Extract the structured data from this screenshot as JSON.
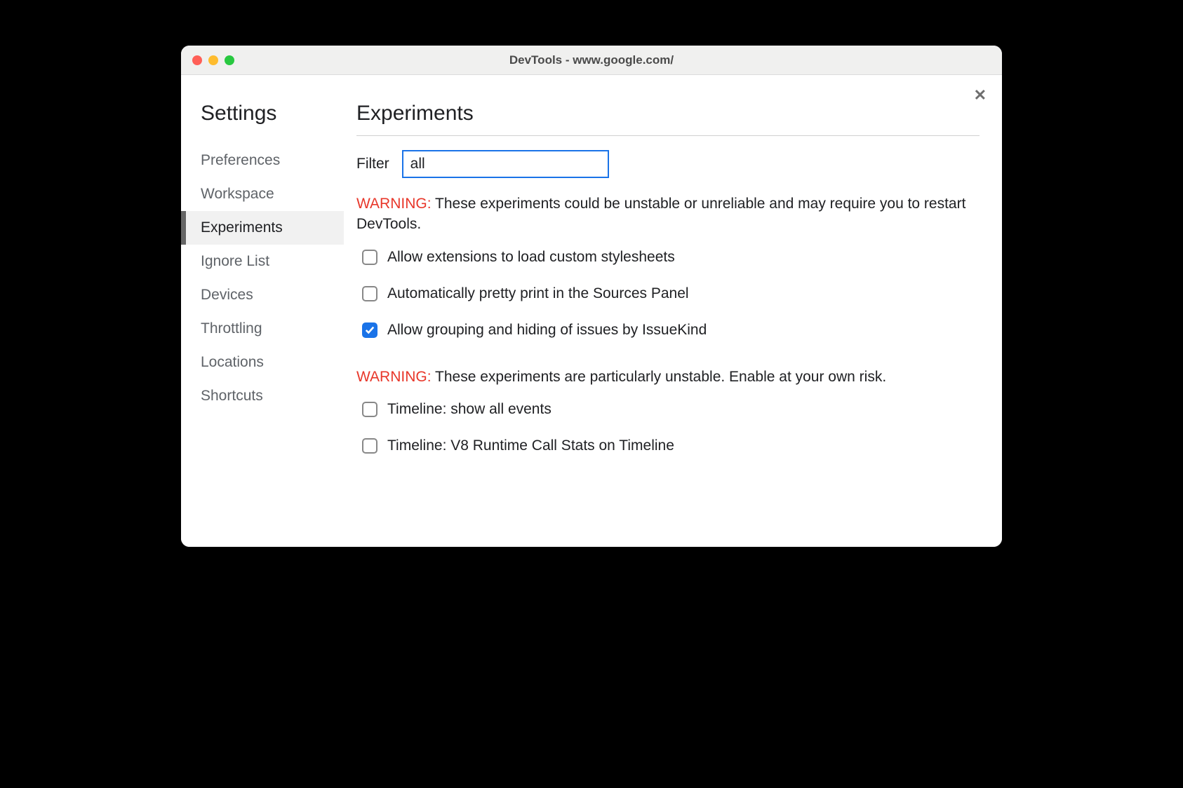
{
  "window": {
    "title": "DevTools - www.google.com/"
  },
  "close_icon": "✕",
  "sidebar": {
    "title": "Settings",
    "items": [
      {
        "label": "Preferences",
        "active": false
      },
      {
        "label": "Workspace",
        "active": false
      },
      {
        "label": "Experiments",
        "active": true
      },
      {
        "label": "Ignore List",
        "active": false
      },
      {
        "label": "Devices",
        "active": false
      },
      {
        "label": "Throttling",
        "active": false
      },
      {
        "label": "Locations",
        "active": false
      },
      {
        "label": "Shortcuts",
        "active": false
      }
    ]
  },
  "main": {
    "title": "Experiments",
    "filter": {
      "label": "Filter",
      "value": "all"
    },
    "warning1": {
      "label": "WARNING:",
      "text": " These experiments could be unstable or unreliable and may require you to restart DevTools."
    },
    "experiments1": [
      {
        "label": "Allow extensions to load custom stylesheets",
        "checked": false
      },
      {
        "label": "Automatically pretty print in the Sources Panel",
        "checked": false
      },
      {
        "label": "Allow grouping and hiding of issues by IssueKind",
        "checked": true
      }
    ],
    "warning2": {
      "label": "WARNING:",
      "text": " These experiments are particularly unstable. Enable at your own risk."
    },
    "experiments2": [
      {
        "label": "Timeline: show all events",
        "checked": false
      },
      {
        "label": "Timeline: V8 Runtime Call Stats on Timeline",
        "checked": false
      }
    ]
  }
}
